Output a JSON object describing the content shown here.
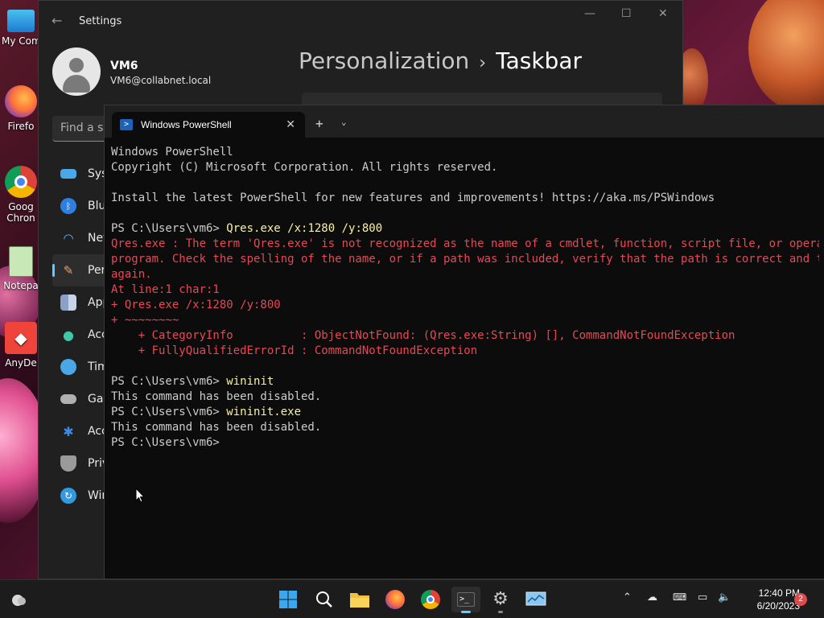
{
  "desktop": {
    "icons": [
      {
        "label": "My Com",
        "icon": "this-pc-icon"
      },
      {
        "label": "Firefo",
        "icon": "firefox-icon"
      },
      {
        "label": "Goog Chron",
        "icon": "chrome-icon"
      },
      {
        "label": "Notepa",
        "icon": "notepad-icon"
      },
      {
        "label": "AnyDe",
        "icon": "anydesk-icon"
      }
    ]
  },
  "settings": {
    "title": "Settings",
    "user": {
      "name": "VM6",
      "email": "VM6@collabnet.local"
    },
    "search_placeholder": "Find a se",
    "nav": [
      {
        "label": "Syst",
        "icon": "system-icon",
        "color": "#4aa8e8"
      },
      {
        "label": "Blue",
        "icon": "bluetooth-icon",
        "color": "#2f7fe0"
      },
      {
        "label": "Net",
        "icon": "network-icon",
        "color": "#6ab8f0"
      },
      {
        "label": "Pers",
        "icon": "personalization-icon",
        "color": "#e8a070"
      },
      {
        "label": "App",
        "icon": "apps-icon",
        "color": "#8aa0c8"
      },
      {
        "label": "Acc",
        "icon": "accounts-icon",
        "color": "#3ec8a8"
      },
      {
        "label": "Tim",
        "icon": "time-language-icon",
        "color": "#4aa8e8"
      },
      {
        "label": "Gar",
        "icon": "gaming-icon",
        "color": "#b0b0b0"
      },
      {
        "label": "Acc",
        "icon": "accessibility-icon",
        "color": "#3a8ae8"
      },
      {
        "label": "Priv",
        "icon": "privacy-icon",
        "color": "#9a9a9a"
      },
      {
        "label": "Win",
        "icon": "windows-update-icon",
        "color": "#2f9ae0"
      }
    ],
    "breadcrumb": {
      "parent": "Personalization",
      "separator": "›",
      "current": "Taskbar"
    }
  },
  "terminal": {
    "tab_title": "Windows PowerShell",
    "lines": [
      {
        "text": "Windows PowerShell",
        "style": ""
      },
      {
        "text": "Copyright (C) Microsoft Corporation. All rights reserved.",
        "style": ""
      },
      {
        "text": "",
        "style": ""
      },
      {
        "text": "Install the latest PowerShell for new features and improvements! https://aka.ms/PSWindows",
        "style": ""
      },
      {
        "text": "",
        "style": ""
      },
      {
        "prompt": "PS C:\\Users\\vm6> ",
        "cmd": "Qres.exe /x:1280 /y:800"
      },
      {
        "text": "Qres.exe : The term 'Qres.exe' is not recognized as the name of a cmdlet, function, script file, or operable",
        "style": "err"
      },
      {
        "text": "program. Check the spelling of the name, or if a path was included, verify that the path is correct and try",
        "style": "err"
      },
      {
        "text": "again.",
        "style": "err"
      },
      {
        "text": "At line:1 char:1",
        "style": "err"
      },
      {
        "text": "+ Qres.exe /x:1280 /y:800",
        "style": "err"
      },
      {
        "text": "+ ~~~~~~~~",
        "style": "err"
      },
      {
        "text": "    + CategoryInfo          : ObjectNotFound: (Qres.exe:String) [], CommandNotFoundException",
        "style": "err"
      },
      {
        "text": "    + FullyQualifiedErrorId : CommandNotFoundException",
        "style": "err"
      },
      {
        "text": "",
        "style": ""
      },
      {
        "prompt": "PS C:\\Users\\vm6> ",
        "cmd": "wininit"
      },
      {
        "text": "This command has been disabled.",
        "style": ""
      },
      {
        "prompt": "PS C:\\Users\\vm6> ",
        "cmd": "wininit.exe"
      },
      {
        "text": "This command has been disabled.",
        "style": ""
      },
      {
        "prompt": "PS C:\\Users\\vm6> ",
        "cmd": ""
      }
    ]
  },
  "taskbar": {
    "apps": [
      {
        "name": "start-button",
        "icon": "windows-logo-icon"
      },
      {
        "name": "search-button",
        "icon": "search-icon"
      },
      {
        "name": "file-explorer",
        "icon": "folder-icon"
      },
      {
        "name": "firefox",
        "icon": "firefox-icon"
      },
      {
        "name": "chrome",
        "icon": "chrome-icon"
      },
      {
        "name": "terminal",
        "icon": "terminal-icon",
        "active": true
      },
      {
        "name": "settings",
        "icon": "gear-icon",
        "running": true
      },
      {
        "name": "resource-monitor",
        "icon": "monitor-icon"
      }
    ],
    "clock": {
      "time": "12:40 PM",
      "date": "6/20/2023"
    },
    "notifications": "2"
  },
  "colors": {
    "accent": "#60cdff",
    "error_text": "#e74856",
    "command_text": "#f9f1a5",
    "terminal_bg": "#0c0c0c"
  }
}
